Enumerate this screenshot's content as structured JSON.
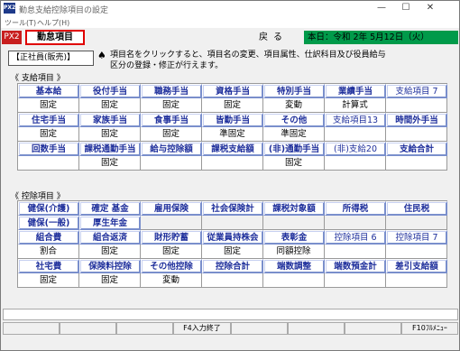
{
  "window": {
    "app_icon": "PX2",
    "title": "勤怠支給控除項目の設定",
    "min_glyph": "—",
    "max_glyph": "☐",
    "close_glyph": "✕"
  },
  "menu": [
    "ツール(T)",
    "ヘルプ(H)"
  ],
  "topbar": {
    "badge": "PX2",
    "tab_label": "勤怠項目",
    "back_label": "戻る",
    "date_text": "本日：令和 2年 5月12日（火）"
  },
  "info": {
    "employee_type": "【正社員(販売)】",
    "spade": "♠",
    "line1": "項目名をクリックすると、項目名の変更、項目属性、仕訳科目及び役員給与",
    "line2": "区分の登録・修正が行えます。"
  },
  "sections": {
    "payment": "《 支給項目 》",
    "deduction": "《 控除項目 》"
  },
  "payment_rows": [
    [
      {
        "t": "基本給",
        "h": 1
      },
      {
        "t": "役付手当",
        "h": 1
      },
      {
        "t": "職務手当",
        "h": 1
      },
      {
        "t": "資格手当",
        "h": 1
      },
      {
        "t": "特別手当",
        "h": 1
      },
      {
        "t": "業績手当",
        "h": 1
      },
      {
        "t": "支給項目 7",
        "h": 1,
        "l": 1
      }
    ],
    [
      {
        "t": "固定"
      },
      {
        "t": "固定"
      },
      {
        "t": "固定"
      },
      {
        "t": "固定"
      },
      {
        "t": "変動"
      },
      {
        "t": "計算式"
      },
      {
        "t": ""
      }
    ],
    [
      {
        "t": "住宅手当",
        "h": 1
      },
      {
        "t": "家族手当",
        "h": 1
      },
      {
        "t": "食事手当",
        "h": 1
      },
      {
        "t": "皆勤手当",
        "h": 1
      },
      {
        "t": "その他",
        "h": 1
      },
      {
        "t": "支給項目13",
        "h": 1,
        "l": 1
      },
      {
        "t": "時間外手当",
        "h": 1
      }
    ],
    [
      {
        "t": "固定"
      },
      {
        "t": "固定"
      },
      {
        "t": "固定"
      },
      {
        "t": "準固定"
      },
      {
        "t": "準固定"
      },
      {
        "t": ""
      },
      {
        "t": ""
      }
    ],
    [
      {
        "t": "回数手当",
        "h": 1
      },
      {
        "t": "課税通勤手当",
        "h": 1
      },
      {
        "t": "給与控除額",
        "h": 1
      },
      {
        "t": "課税支給額",
        "h": 1
      },
      {
        "t": "(非)通勤手当",
        "h": 1
      },
      {
        "t": "(非)支給20",
        "h": 1,
        "l": 1
      },
      {
        "t": "支給合計",
        "h": 1
      }
    ],
    [
      {
        "t": ""
      },
      {
        "t": "固定"
      },
      {
        "t": ""
      },
      {
        "t": ""
      },
      {
        "t": "固定"
      },
      {
        "t": ""
      },
      {
        "t": ""
      }
    ]
  ],
  "deduction_rows": [
    [
      {
        "t": "健保(介護)",
        "h": 1
      },
      {
        "t": "確定 基金",
        "h": 1
      },
      {
        "t": "雇用保険",
        "h": 1
      },
      {
        "t": "社会保険計",
        "h": 1
      },
      {
        "t": "課税対象額",
        "h": 1
      },
      {
        "t": "所得税",
        "h": 1
      },
      {
        "t": "住民税",
        "h": 1
      }
    ],
    [
      {
        "t": "健保(一般)",
        "h": 1
      },
      {
        "t": "厚生年金",
        "h": 1
      },
      {
        "t": "",
        "b": 1
      },
      {
        "t": "",
        "b": 1
      },
      {
        "t": "",
        "b": 1
      },
      {
        "t": "",
        "b": 1
      },
      {
        "t": "",
        "b": 1
      }
    ],
    [
      {
        "t": "組合費",
        "h": 1
      },
      {
        "t": "組合返済",
        "h": 1
      },
      {
        "t": "財形貯蓄",
        "h": 1
      },
      {
        "t": "従業員持株会",
        "h": 1
      },
      {
        "t": "表彰金",
        "h": 1
      },
      {
        "t": "控除項目 6",
        "h": 1,
        "l": 1
      },
      {
        "t": "控除項目 7",
        "h": 1,
        "l": 1
      }
    ],
    [
      {
        "t": "割合"
      },
      {
        "t": "固定"
      },
      {
        "t": "固定"
      },
      {
        "t": "固定"
      },
      {
        "t": "同額控除"
      },
      {
        "t": ""
      },
      {
        "t": ""
      }
    ],
    [
      {
        "t": "社宅費",
        "h": 1
      },
      {
        "t": "保険料控除",
        "h": 1
      },
      {
        "t": "その他控除",
        "h": 1
      },
      {
        "t": "控除合計",
        "h": 1
      },
      {
        "t": "端数調整",
        "h": 1
      },
      {
        "t": "端数預金計",
        "h": 1
      },
      {
        "t": "差引支給額",
        "h": 1
      }
    ],
    [
      {
        "t": "固定"
      },
      {
        "t": "固定"
      },
      {
        "t": "変動"
      },
      {
        "t": ""
      },
      {
        "t": ""
      },
      {
        "t": ""
      },
      {
        "t": ""
      }
    ]
  ],
  "fkeys": [
    "",
    "",
    "",
    "F4入力終了",
    "",
    "",
    "",
    "F10ﾌﾙﾒﾆｭｰ"
  ]
}
